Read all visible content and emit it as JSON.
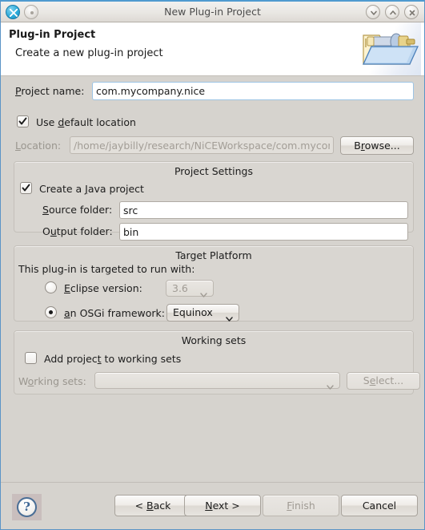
{
  "window": {
    "title": "New Plug-in Project",
    "controls": {
      "minimize": "minimize-icon",
      "maximize": "maximize-icon",
      "close": "close-icon"
    },
    "app_icon": "eclipse-app-icon",
    "menu_icon": "window-menu-icon"
  },
  "header": {
    "title": "Plug-in Project",
    "subtitle": "Create a new plug-in project",
    "banner_icon": "plugin-folder-icon"
  },
  "project": {
    "name_label": "Project name:",
    "name_label_mnemonic": "P",
    "name_value": "com.mycompany.nice",
    "use_default_label": "Use default location",
    "use_default_mnemonic": "d",
    "use_default_checked": true,
    "location_label": "Location:",
    "location_mnemonic": "L",
    "location_value": "/home/jaybilly/research/NiCEWorkspace/com.mycomp",
    "location_enabled": false,
    "browse_label": "Browse...",
    "browse_mnemonic": "r",
    "browse_enabled": true
  },
  "project_settings": {
    "title": "Project Settings",
    "create_java_label": "Create a Java project",
    "create_java_mnemonic": "J",
    "create_java_checked": true,
    "source_label": "Source folder:",
    "source_mnemonic": "S",
    "source_value": "src",
    "output_label": "Output folder:",
    "output_mnemonic": "u",
    "output_value": "bin"
  },
  "target_platform": {
    "title": "Target Platform",
    "intro": "This plug-in is targeted to run with:",
    "eclipse_option_label": "Eclipse version:",
    "eclipse_option_mnemonic": "E",
    "eclipse_selected": false,
    "eclipse_version_value": "3.6",
    "eclipse_version_enabled": false,
    "osgi_option_label": "an OSGi framework:",
    "osgi_option_mnemonic": "a",
    "osgi_selected": true,
    "osgi_framework_value": "Equinox",
    "osgi_framework_enabled": true
  },
  "working_sets": {
    "title": "Working sets",
    "add_label": "Add project to working sets",
    "add_mnemonic": "t",
    "add_checked": false,
    "sets_label": "Working sets:",
    "sets_mnemonic": "o",
    "sets_value": "",
    "sets_enabled": false,
    "select_label": "Select...",
    "select_mnemonic": "e",
    "select_enabled": false
  },
  "buttons": {
    "help": "?",
    "back": "< Back",
    "back_mnemonic": "B",
    "back_enabled": true,
    "next": "Next >",
    "next_mnemonic": "N",
    "next_enabled": true,
    "finish": "Finish",
    "finish_mnemonic": "F",
    "finish_enabled": false,
    "cancel": "Cancel",
    "cancel_enabled": true
  },
  "colors": {
    "dialog_bg": "#d6d3ce",
    "group_bg": "#d9d6d1",
    "header_bg": "#ffffff",
    "accent_border": "#4f9ad0",
    "focus_border": "#9dc4e4"
  }
}
